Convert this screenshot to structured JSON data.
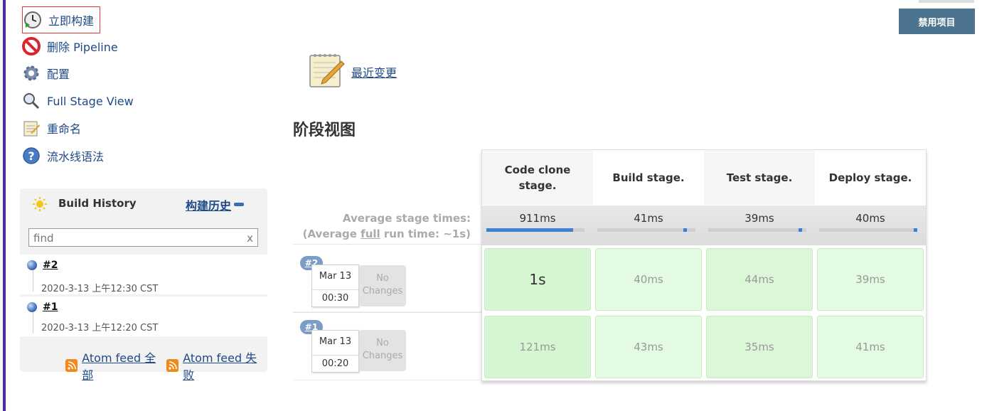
{
  "side_tasks": [
    {
      "label": "立即构建",
      "icon": "clock-build-icon"
    },
    {
      "label": "删除 Pipeline",
      "icon": "no-entry-icon"
    },
    {
      "label": "配置",
      "icon": "gear-icon"
    },
    {
      "label": "Full Stage View",
      "icon": "magnifier-icon"
    },
    {
      "label": "重命名",
      "icon": "notepad-icon"
    },
    {
      "label": "流水线语法",
      "icon": "help-icon"
    }
  ],
  "build_history": {
    "title": "Build History",
    "link_label": "构建历史",
    "search_placeholder": "find",
    "search_clear": "x",
    "builds": [
      {
        "number": "#2",
        "date": "2020-3-13 上午12:30 CST"
      },
      {
        "number": "#1",
        "date": "2020-3-13 上午12:20 CST"
      }
    ],
    "feeds": [
      {
        "label": "Atom feed 全部"
      },
      {
        "label": "Atom feed 失败"
      }
    ]
  },
  "header": {
    "disable_button": "禁用项目"
  },
  "main": {
    "recent_changes": "最近变更",
    "stage_view_title": "阶段视图"
  },
  "stage_view": {
    "avg_line1": "Average stage times:",
    "avg_line2_pre": "(Average ",
    "avg_line2_link": "full",
    "avg_line2_post": " run time: ~1s)",
    "stages": [
      {
        "name": "Code clone stage.",
        "avg": "911ms",
        "progress": 0.88
      },
      {
        "name": "Build stage.",
        "avg": "41ms",
        "progress": 0.04
      },
      {
        "name": "Test stage.",
        "avg": "39ms",
        "progress": 0.04
      },
      {
        "name": "Deploy stage.",
        "avg": "40ms",
        "progress": 0.04
      }
    ],
    "runs": [
      {
        "badge": "#2",
        "date": "Mar 13",
        "time": "00:30",
        "changes": "No Changes",
        "durations": [
          "1s",
          "40ms",
          "44ms",
          "39ms"
        ]
      },
      {
        "badge": "#1",
        "date": "Mar 13",
        "time": "00:20",
        "changes": "No Changes",
        "durations": [
          "121ms",
          "43ms",
          "35ms",
          "41ms"
        ]
      }
    ]
  },
  "colors": {
    "link": "#204a87",
    "button": "#4c7490",
    "success_cell": "#e3fbe0",
    "success_cell_alt": "#d6f5d2",
    "progress": "#3a7fd8"
  }
}
